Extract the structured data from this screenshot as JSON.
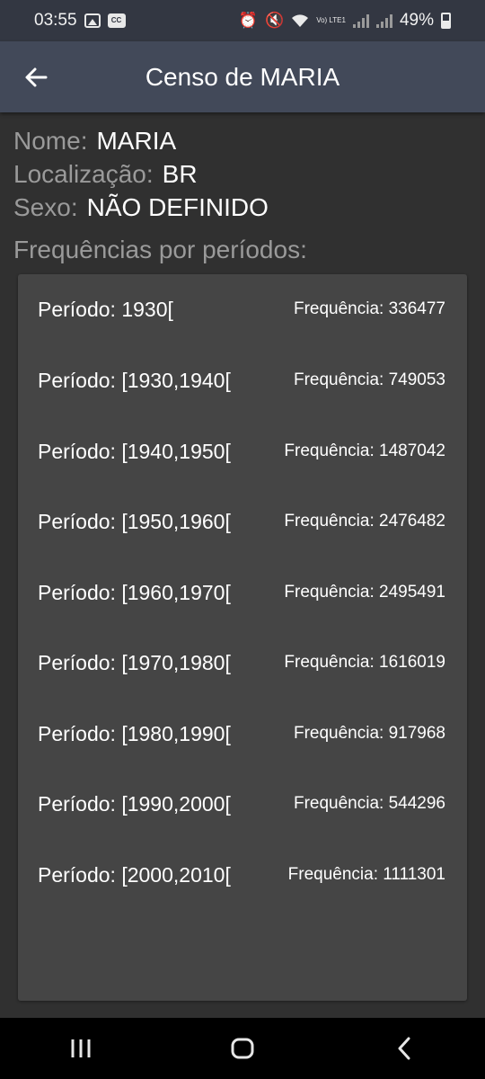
{
  "status_bar": {
    "time": "03:55",
    "battery_percent": "49%",
    "volte_label": "Vo) LTE1"
  },
  "app_bar": {
    "title": "Censo de MARIA"
  },
  "info": {
    "name_label": "Nome:",
    "name_value": "MARIA",
    "location_label": "Localização:",
    "location_value": "BR",
    "sex_label": "Sexo:",
    "sex_value": "NÃO DEFINIDO"
  },
  "frequencies": {
    "heading": "Frequências por períodos:",
    "rows": [
      {
        "period": "Período: 1930[",
        "frequency": "Frequência: 336477"
      },
      {
        "period": "Período: [1930,1940[",
        "frequency": "Frequência: 749053"
      },
      {
        "period": "Período: [1940,1950[",
        "frequency": "Frequência: 1487042"
      },
      {
        "period": "Período: [1950,1960[",
        "frequency": "Frequência: 2476482"
      },
      {
        "period": "Período: [1960,1970[",
        "frequency": "Frequência: 2495491"
      },
      {
        "period": "Período: [1970,1980[",
        "frequency": "Frequência: 1616019"
      },
      {
        "period": "Período: [1980,1990[",
        "frequency": "Frequência: 917968"
      },
      {
        "period": "Período: [1990,2000[",
        "frequency": "Frequência: 544296"
      },
      {
        "period": "Período: [2000,2010[",
        "frequency": "Frequência: 1111301"
      }
    ]
  },
  "icons": {
    "back": "arrow-left-icon",
    "nav_recents": "recent-apps-icon",
    "nav_home": "home-icon",
    "nav_back": "nav-back-icon"
  },
  "colors": {
    "app_bar": "#424959",
    "status_bar": "#333742",
    "background": "#303030",
    "card": "#454545",
    "label_gray": "#9a9a9a"
  }
}
